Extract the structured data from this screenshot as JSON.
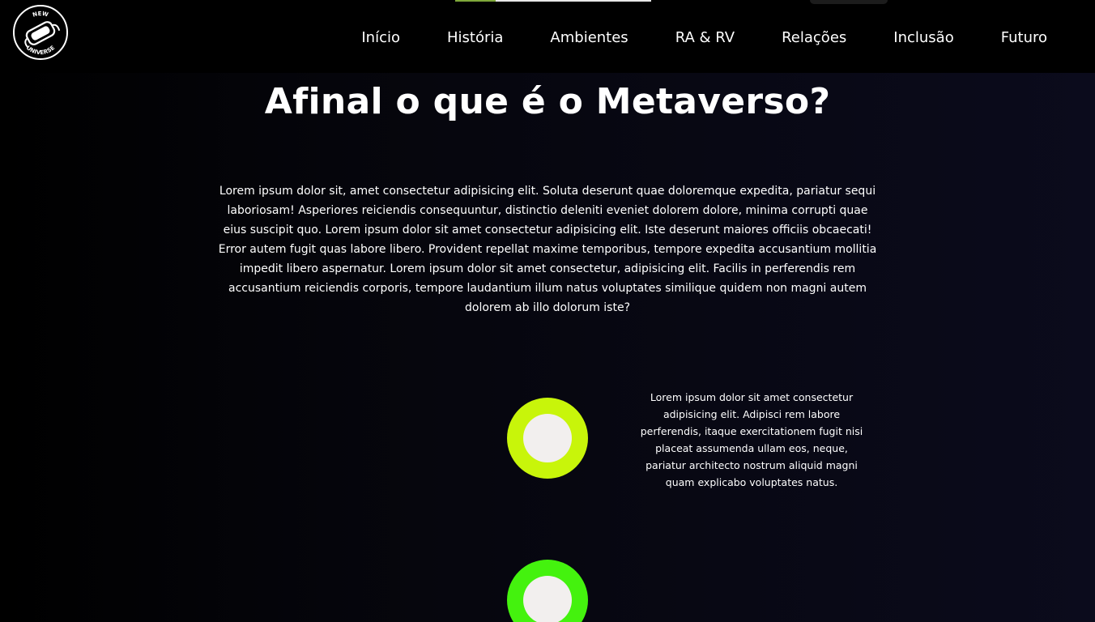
{
  "brand": {
    "logo_top_text": "NEW",
    "logo_bottom_text": "UNIVERSE"
  },
  "nav": {
    "items": [
      {
        "label": "Início"
      },
      {
        "label": "História"
      },
      {
        "label": "Ambientes"
      },
      {
        "label": "RA & RV"
      },
      {
        "label": "Relações"
      },
      {
        "label": "Inclusão"
      },
      {
        "label": "Futuro"
      }
    ]
  },
  "main": {
    "title": "Afinal o que é o Metaverso?",
    "intro": "Lorem ipsum dolor sit, amet consectetur adipisicing elit. Soluta deserunt quae doloremque expedita, pariatur sequi laboriosam! Asperiores reiciendis consequuntur, distinctio deleniti eveniet dolorem dolore, minima corrupti quae eius suscipit quo. Lorem ipsum dolor sit amet consectetur adipisicing elit. Iste deserunt maiores officiis obcaecati! Error autem fugit quas labore libero. Provident repellat maxime temporibus, tempore expedita accusantium mollitia impedit libero aspernatur. Lorem ipsum dolor sit amet consectetur, adipisicing elit. Facilis in perferendis rem accusantium reiciendis corporis, tempore laudantium illum natus voluptates similique quidem non magni autem dolorem ab illo dolorum iste?",
    "timeline": [
      {
        "color": "#c8f50a",
        "text": "Lorem ipsum dolor sit amet consectetur adipisicing elit. Adipisci rem labore perferendis, itaque exercitationem fugit nisi placeat assumenda ullam eos, neque, pariatur architecto nostrum aliquid magni quam explicabo voluptates natus."
      },
      {
        "color": "#44f20e",
        "text": ""
      }
    ]
  }
}
